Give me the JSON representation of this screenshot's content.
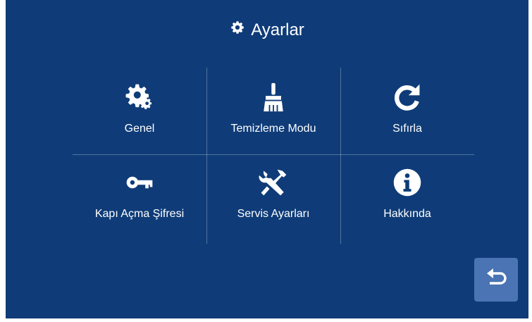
{
  "header": {
    "title": "Ayarlar",
    "icon": "gear-icon"
  },
  "menu": {
    "items": [
      {
        "label": "Genel",
        "icon": "gears-icon"
      },
      {
        "label": "Temizleme Modu",
        "icon": "broom-icon"
      },
      {
        "label": "Sıfırla",
        "icon": "refresh-icon"
      },
      {
        "label": "Kapı Açma Şifresi",
        "icon": "key-icon"
      },
      {
        "label": "Servis Ayarları",
        "icon": "tools-icon"
      },
      {
        "label": "Hakkında",
        "icon": "info-icon"
      }
    ]
  },
  "footer": {
    "back_icon": "back-arrow-icon"
  },
  "colors": {
    "background": "#0f3c78",
    "back_button": "#4a74b3",
    "text": "#ffffff"
  }
}
